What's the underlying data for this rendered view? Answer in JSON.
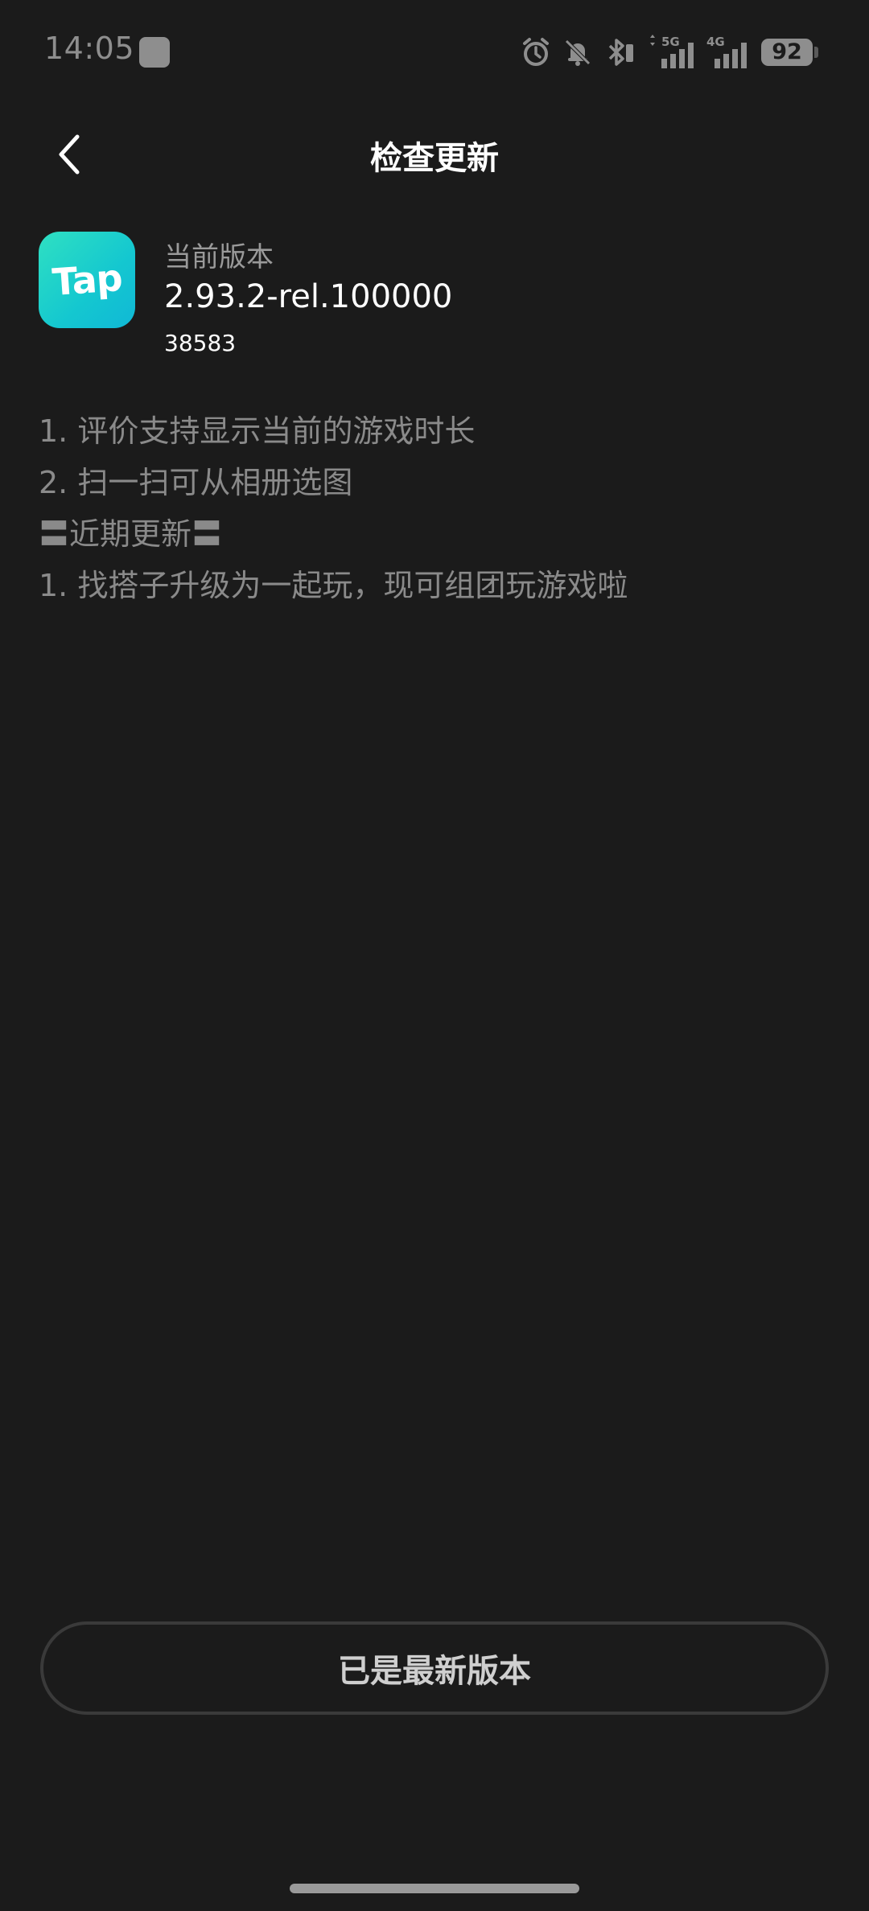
{
  "status_bar": {
    "time": "14:05",
    "signal_5g": "5G",
    "signal_4g": "4G",
    "battery": "92"
  },
  "header": {
    "title": "检查更新"
  },
  "app": {
    "logo_text": "Tap",
    "version_label": "当前版本",
    "version": "2.93.2-rel.100000",
    "build": "38583",
    "brand_color_start": "#2fe0c2",
    "brand_color_end": "#10b8d6"
  },
  "changelog": [
    "1. 评价支持显示当前的游戏时长",
    "2. 扫一扫可从相册选图",
    "〓近期更新〓",
    "1. 找搭子升级为一起玩，现可组团玩游戏啦"
  ],
  "action": {
    "label": "已是最新版本"
  }
}
